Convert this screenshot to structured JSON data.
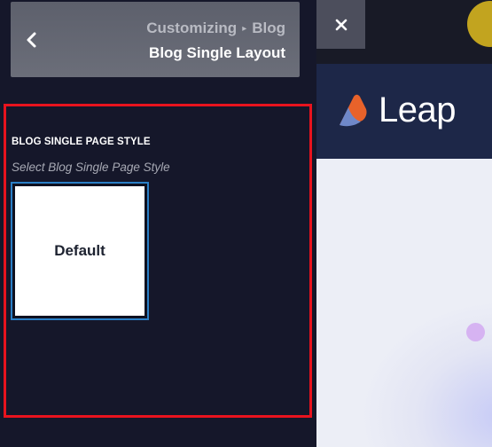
{
  "header": {
    "breadcrumb": [
      "Customizing",
      "Blog"
    ],
    "breadcrumb_separator": "▸",
    "section_title": "Blog Single Layout"
  },
  "control": {
    "label": "BLOG SINGLE PAGE STYLE",
    "description": "Select Blog Single Page Style",
    "options": [
      {
        "label": "Default",
        "selected": true
      }
    ]
  },
  "preview": {
    "logo_text": "Leap"
  },
  "colors": {
    "panel_bg": "#15172a",
    "header_bg": "#6b6e79",
    "highlight_border": "#e8131e",
    "selected_border": "#2b7fc6",
    "preview_header_bg": "#1d2748",
    "logo_orange": "#e8622a",
    "logo_blue": "#6f88c9"
  },
  "icons": {
    "back": "chevron-left-icon",
    "close": "close-icon",
    "logo": "leap-logo-icon"
  }
}
